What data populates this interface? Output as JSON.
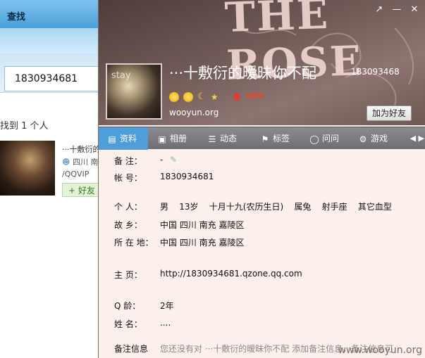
{
  "search_window": {
    "title": "查找",
    "search_value": "1830934681",
    "found_text": "找到 1 个人",
    "result": {
      "name": "···十敷衍的",
      "location": "四川 南",
      "vip": "/QQVIP",
      "add_button": "+ 好友"
    }
  },
  "profile": {
    "cover_text": "THE ROSE",
    "nickname": "···十敷衍的暧昧你不配",
    "qq_number": "1830934681",
    "qq_number_header": "183093468",
    "avatar_text": "stay",
    "site": "wooyun.org",
    "vip_label": "VIP3",
    "add_friend_button": "加为好友",
    "tabs": [
      {
        "label": "资料",
        "icon": "profile-card-icon"
      },
      {
        "label": "相册",
        "icon": "photo-album-icon"
      },
      {
        "label": "动态",
        "icon": "feed-icon"
      },
      {
        "label": "标签",
        "icon": "tag-icon"
      },
      {
        "label": "问问",
        "icon": "question-icon"
      },
      {
        "label": "游戏",
        "icon": "game-icon"
      }
    ],
    "fields": {
      "remark": {
        "label": "备    注：",
        "value": "-"
      },
      "account": {
        "label": "帐    号：",
        "value": "1830934681"
      },
      "personal": {
        "label": "个    人：",
        "value": "男    13岁    十月十九(农历生日)    属兔    射手座    其它血型"
      },
      "hometown": {
        "label": "故    乡：",
        "value": "中国 四川 南充 嘉陵区"
      },
      "location": {
        "label": "所 在 地：",
        "value": "中国 四川 南充 嘉陵区"
      },
      "homepage": {
        "label": "主    页：",
        "value": "http://1830934681.qzone.qq.com"
      },
      "qage": {
        "label": "Q    龄：",
        "value": "2年"
      },
      "realname": {
        "label": "姓    名：",
        "value": "...."
      },
      "remark_info": {
        "label": "备注信息",
        "value": "您还没有对 ···十敷衍的暧昧你不配 添加备注信息，备注信息可"
      }
    }
  },
  "watermark": "www.wooyun.org"
}
